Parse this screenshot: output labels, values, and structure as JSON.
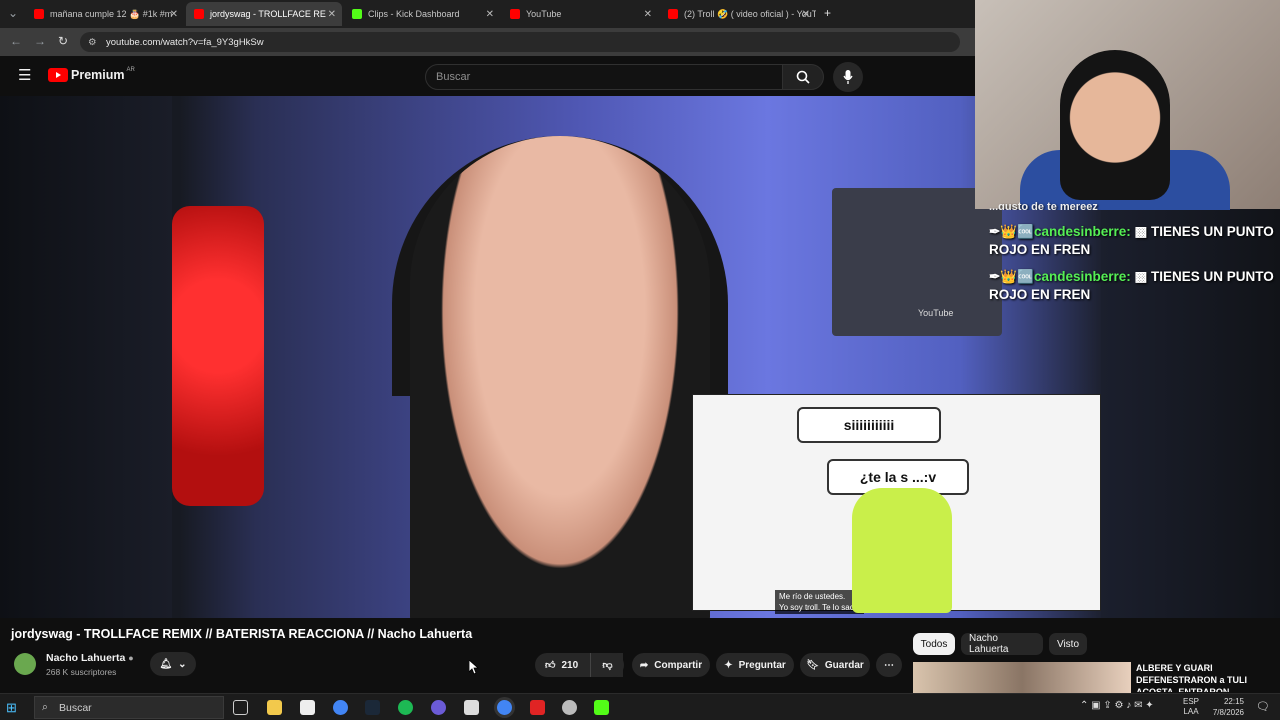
{
  "browser": {
    "tabs": [
      {
        "label": "mañana cumple 12 🎂 #1k #m",
        "icon_color": "#ff0000"
      },
      {
        "label": "jordyswag - TROLLFACE RE",
        "icon_color": "#ff0000",
        "active": true
      },
      {
        "label": "Clips - Kick Dashboard",
        "icon_color": "#53fc18"
      },
      {
        "label": "YouTube",
        "icon_color": "#ff0000"
      },
      {
        "label": "(2) Troll 🤣 ( video oficial ) - YouT",
        "icon_color": "#ff0000"
      }
    ],
    "new_tab": "+",
    "url": "youtube.com/watch?v=fa_9Y3gHkSw"
  },
  "youtube": {
    "logo_text": "Premium",
    "logo_badge": "AR",
    "search_placeholder": "Buscar"
  },
  "video": {
    "meme_bubble_1": "siiiiiiiiiii",
    "meme_bubble_2": "¿te la s ...:v",
    "meme_subtitle_1": "Me río de ustedes.",
    "meme_subtitle_2": "Yo soy troll. Te lo saco.",
    "plaque_text": "YouTube"
  },
  "chat": {
    "partial": "...gusto de te mereez",
    "messages": [
      {
        "user": "candesinberre:",
        "text": "TIENES UN PUNTO ROJO EN FREN"
      },
      {
        "user": "candesinberre:",
        "text": "TIENES UN PUNTO ROJO EN FREN"
      }
    ]
  },
  "watch": {
    "title": "jordyswag - TROLLFACE REMIX // BATERISTA REACCIONA // Nacho Lahuerta",
    "channel": "Nacho Lahuerta",
    "subscribers": "268 K suscriptores",
    "likes": "210",
    "share": "Compartir",
    "ask": "Preguntar",
    "save": "Guardar"
  },
  "related": {
    "chips": [
      "Todos",
      "Nacho Lahuerta",
      "Visto"
    ],
    "first_title": "ALBERE Y GUARI DEFENESTRARON a TULI ACOSTA, ENTRARON"
  },
  "taskbar": {
    "search_placeholder": "Buscar",
    "lang_1": "ESP",
    "lang_2": "LAA",
    "time": "22:15",
    "date": "7/8/2026"
  },
  "colors": {
    "youtube_red": "#ff0000",
    "kick_green": "#53fc18",
    "chat_user": "#55ee55"
  }
}
